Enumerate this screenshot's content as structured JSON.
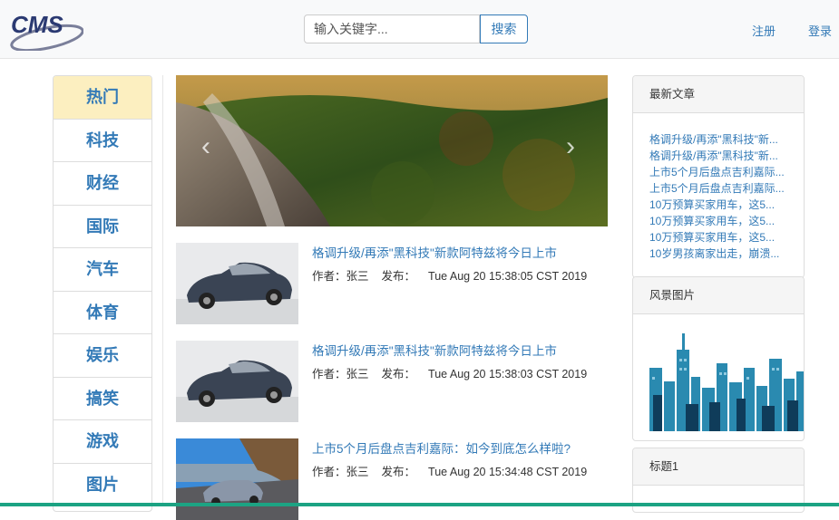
{
  "brand": {
    "logo_text": "CMS"
  },
  "search": {
    "placeholder": "输入关键字...",
    "button_label": "搜索"
  },
  "nav": {
    "register": "注册",
    "login": "登录"
  },
  "categories": [
    {
      "label": "热门",
      "active": true
    },
    {
      "label": "科技"
    },
    {
      "label": "财经"
    },
    {
      "label": "国际"
    },
    {
      "label": "汽车"
    },
    {
      "label": "体育"
    },
    {
      "label": "娱乐"
    },
    {
      "label": "搞笑"
    },
    {
      "label": "游戏"
    },
    {
      "label": "图片"
    }
  ],
  "carousel": {
    "prev": "‹",
    "next": "›"
  },
  "articles": [
    {
      "title": "格调升级/再添\"黑科技\"新款阿特兹将今日上市",
      "author_label": "作者：张三",
      "publish_label": "发布：",
      "date": "Tue Aug 20 15:38:05 CST 2019"
    },
    {
      "title": "格调升级/再添\"黑科技\"新款阿特兹将今日上市",
      "author_label": "作者：张三",
      "publish_label": "发布：",
      "date": "Tue Aug 20 15:38:03 CST 2019"
    },
    {
      "title": "上市5个月后盘点吉利嘉际：如今到底怎么样啦?",
      "author_label": "作者：张三",
      "publish_label": "发布：",
      "date": "Tue Aug 20 15:34:48 CST 2019"
    }
  ],
  "recent_panel": {
    "title": "最新文章",
    "items": [
      "格调升级/再添\"黑科技\"新...",
      "格调升级/再添\"黑科技\"新...",
      "上市5个月后盘点吉利嘉际...",
      "上市5个月后盘点吉利嘉际...",
      "10万预算买家用车，这5...",
      "10万预算买家用车，这5...",
      "10万预算买家用车，这5...",
      "10岁男孩离家出走，崩溃..."
    ]
  },
  "scenery_panel": {
    "title": "风景图片"
  },
  "third_panel": {
    "title": "标题1"
  }
}
